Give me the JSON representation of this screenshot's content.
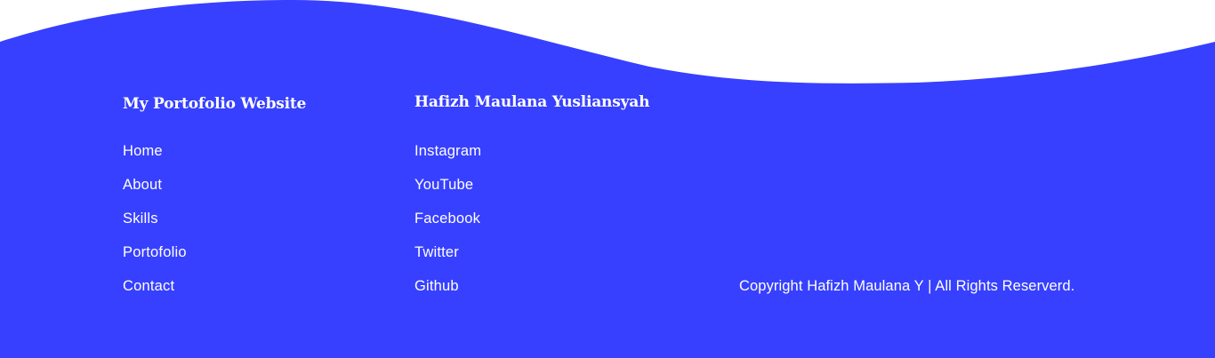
{
  "colors": {
    "footer_background": "#3740ff",
    "page_background": "#ffffff",
    "text": "#ffffff"
  },
  "site": {
    "title": "My Portofolio Website",
    "links": [
      "Home",
      "About",
      "Skills",
      "Portofolio",
      "Contact"
    ]
  },
  "social": {
    "title": "Hafizh Maulana Yusliansyah",
    "links": [
      "Instagram",
      "YouTube",
      "Facebook",
      "Twitter",
      "Github"
    ]
  },
  "copyright": "Copyright Hafizh Maulana Y | All Rights Reserverd."
}
